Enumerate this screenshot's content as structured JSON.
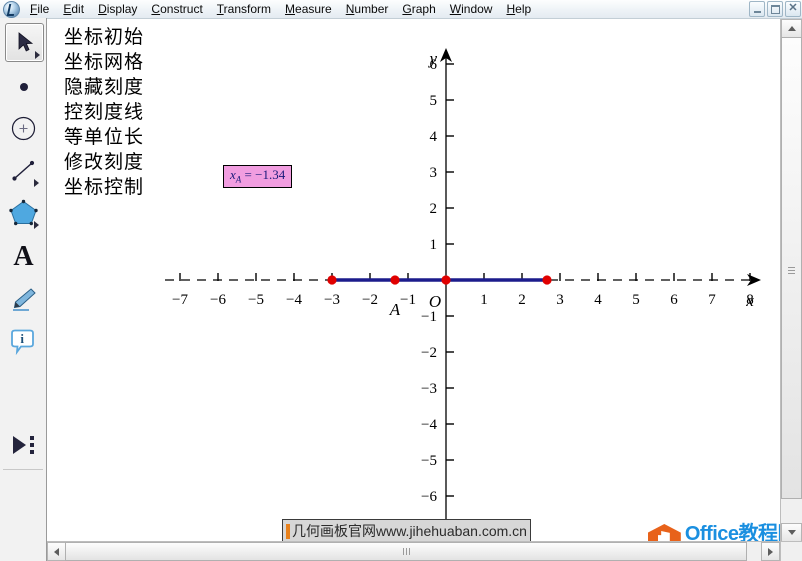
{
  "window": {
    "app_icon": "sketchpad-icon",
    "controls": [
      {
        "name": "minimize-button",
        "glyph": "–"
      },
      {
        "name": "restore-button",
        "glyph": "❐"
      },
      {
        "name": "close-button",
        "glyph": "✕"
      }
    ]
  },
  "menubar": {
    "items": [
      {
        "label": "File",
        "accel": "F"
      },
      {
        "label": "Edit",
        "accel": "E"
      },
      {
        "label": "Display",
        "accel": "D"
      },
      {
        "label": "Construct",
        "accel": "C"
      },
      {
        "label": "Transform",
        "accel": "T"
      },
      {
        "label": "Measure",
        "accel": "M"
      },
      {
        "label": "Number",
        "accel": "N"
      },
      {
        "label": "Graph",
        "accel": "G"
      },
      {
        "label": "Window",
        "accel": "W"
      },
      {
        "label": "Help",
        "accel": "H"
      }
    ]
  },
  "toolbox": {
    "tools": [
      {
        "name": "arrow-select-tool",
        "selected": true
      },
      {
        "name": "point-tool",
        "selected": false
      },
      {
        "name": "compass-circle-tool",
        "selected": false
      },
      {
        "name": "straightedge-line-tool",
        "selected": false
      },
      {
        "name": "polygon-tool",
        "selected": false
      },
      {
        "name": "text-tool",
        "selected": false
      },
      {
        "name": "marker-pen-tool",
        "selected": false
      },
      {
        "name": "information-tool",
        "selected": false
      },
      {
        "name": "custom-tool",
        "selected": false
      }
    ]
  },
  "script_buttons": [
    {
      "label": "坐标初始"
    },
    {
      "label": "坐标网格"
    },
    {
      "label": "隐藏刻度"
    },
    {
      "label": "控刻度线"
    },
    {
      "label": "等单位长"
    },
    {
      "label": "修改刻度"
    },
    {
      "label": "坐标控制"
    }
  ],
  "measurement": {
    "variable": "x",
    "subscript": "A",
    "equals": "=",
    "value": "−1.34",
    "background": "#f19de0",
    "text_color": "#1a1a7a"
  },
  "watermark": {
    "cn": "几何画板官网",
    "en": "www.jihehuaban.com.cn",
    "accent": "#e8811c"
  },
  "logo": {
    "title_en": "Office",
    "title_cn": "教程网",
    "url": "www.office26.com",
    "brand_blue": "#1a8fe0",
    "brand_orange": "#e8621a"
  },
  "chart_data": {
    "type": "scatter",
    "title": "",
    "xlabel": "x",
    "ylabel": "y",
    "origin_label": "O",
    "xlim": [
      -7.6,
      8.2
    ],
    "ylim": [
      -6.2,
      6.3
    ],
    "xticks": [
      -7,
      -6,
      -5,
      -4,
      -3,
      -2,
      -1,
      1,
      2,
      3,
      4,
      5,
      6,
      7,
      8
    ],
    "yticks": [
      6,
      5,
      4,
      3,
      2,
      1,
      -1,
      -2,
      -3,
      -4,
      -5,
      -6
    ],
    "grid": false,
    "axis_style": "dashed-black-with-ticks",
    "axis_color": "#000000",
    "segment": {
      "name": "highlighted-interval",
      "from": -3.0,
      "to": 2.66,
      "color": "#1c1c8c",
      "width": 3
    },
    "points": [
      {
        "label": "",
        "x": -3.0,
        "y": 0,
        "color": "#e00000"
      },
      {
        "label": "A",
        "x": -1.34,
        "y": 0,
        "color": "#e00000"
      },
      {
        "label": "",
        "x": 0,
        "y": 0,
        "color": "#e00000"
      },
      {
        "label": "",
        "x": 2.66,
        "y": 0,
        "color": "#e00000"
      }
    ],
    "annotations": [
      {
        "text": "x_A = -1.34",
        "x": -5.0,
        "y": 3.1
      }
    ]
  },
  "scrollbars": {
    "horizontal": {
      "name": "horizontal-scrollbar",
      "thumb_pct": 78
    },
    "vertical": {
      "name": "vertical-scrollbar",
      "thumb_pct": 92
    }
  }
}
